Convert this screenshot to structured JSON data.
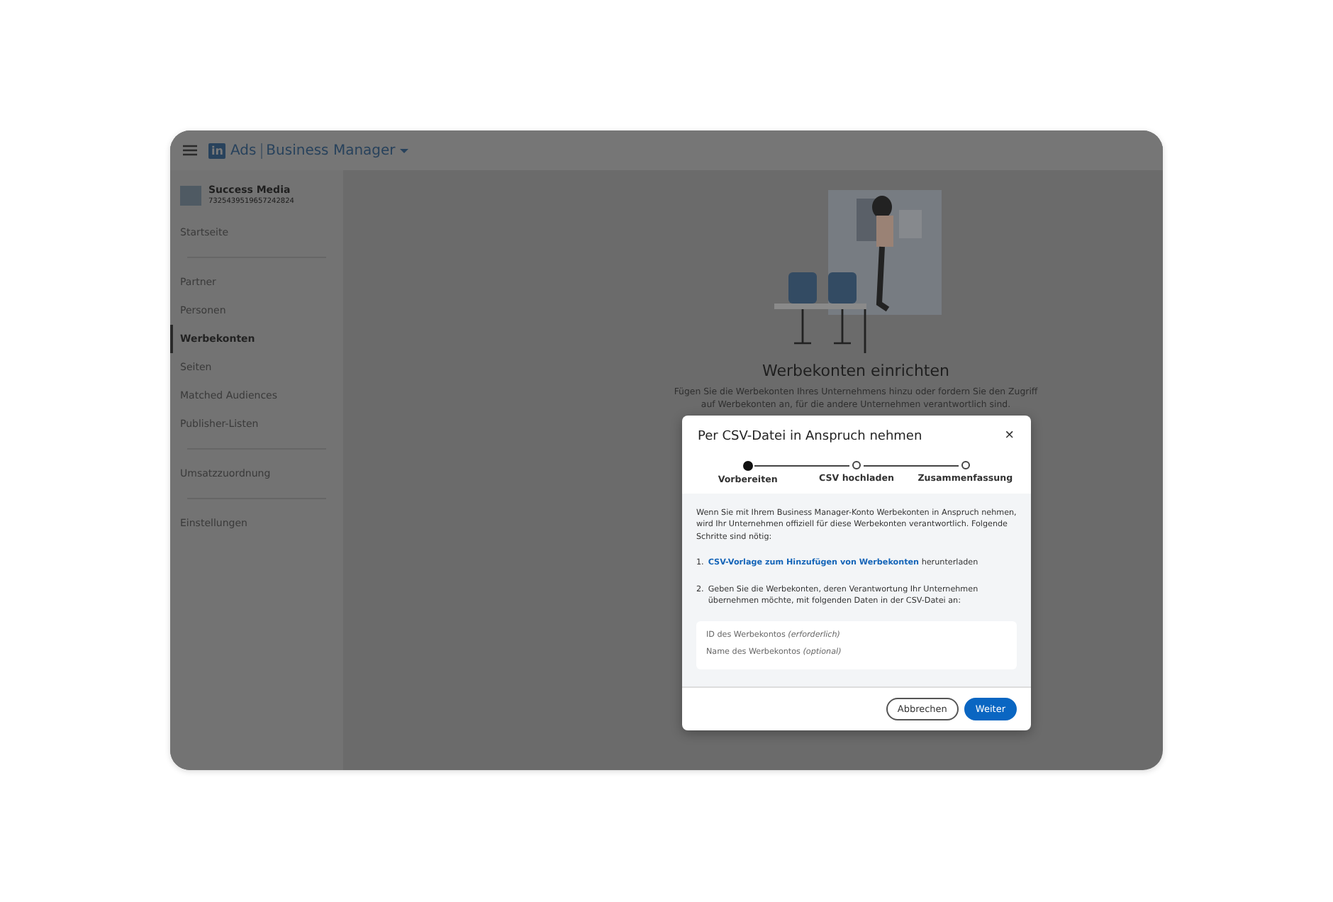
{
  "topbar": {
    "logo": "in",
    "product": "Ads",
    "title": "Business Manager"
  },
  "sidebar": {
    "account": {
      "name": "Success Media",
      "id": "7325439519657242824"
    },
    "groups": [
      {
        "items": [
          {
            "label": "Startseite",
            "selected": false
          }
        ]
      },
      {
        "items": [
          {
            "label": "Partner",
            "selected": false
          },
          {
            "label": "Personen",
            "selected": false
          },
          {
            "label": "Werbekonten",
            "selected": true
          },
          {
            "label": "Seiten",
            "selected": false
          },
          {
            "label": "Matched Audiences",
            "selected": false
          },
          {
            "label": "Publisher-Listen",
            "selected": false
          }
        ]
      },
      {
        "items": [
          {
            "label": "Umsatzzuordnung",
            "selected": false
          }
        ]
      },
      {
        "items": [
          {
            "label": "Einstellungen",
            "selected": false
          }
        ]
      }
    ]
  },
  "empty_state": {
    "title": "Werbekonten einrichten",
    "description": "Fügen Sie die Werbekonten Ihres Unternehmens hinzu oder fordern Sie den Zugriff auf Werbekonten an, für die andere Unternehmen verantwortlich sind."
  },
  "dialog": {
    "title": "Per CSV-Datei in Anspruch nehmen",
    "close": "×",
    "steps": [
      {
        "label": "Vorbereiten",
        "selected": true
      },
      {
        "label": "CSV hochladen",
        "selected": false
      },
      {
        "label": "Zusammenfassung",
        "selected": false
      }
    ],
    "intro": "Wenn Sie mit Ihrem Business Manager-Konto Werbekonten in Anspruch nehmen, wird Ihr Unternehmen offiziell für diese Werbekonten verantwortlich. Folgende Schritte sind nötig:",
    "instructions": [
      {
        "kind": "link",
        "number": "1.",
        "link": "CSV-Vorlage zum Hinzufügen von Werbekonten",
        "text": "herunterladen"
      },
      {
        "kind": "text",
        "number": "2.",
        "text": "Geben Sie die Werbekonten, deren Verantwortung Ihr Unternehmen übernehmen möchte, mit folgenden Daten in der CSV-Datei an:"
      }
    ],
    "fields": [
      "ID des Werbekontos *(erforderlich)*",
      "Name des Werbekontos *(optional)*"
    ],
    "buttons": [
      {
        "kind": "secondary",
        "label": "Abbrechen"
      },
      {
        "kind": "primary",
        "label": "Weiter"
      }
    ]
  }
}
